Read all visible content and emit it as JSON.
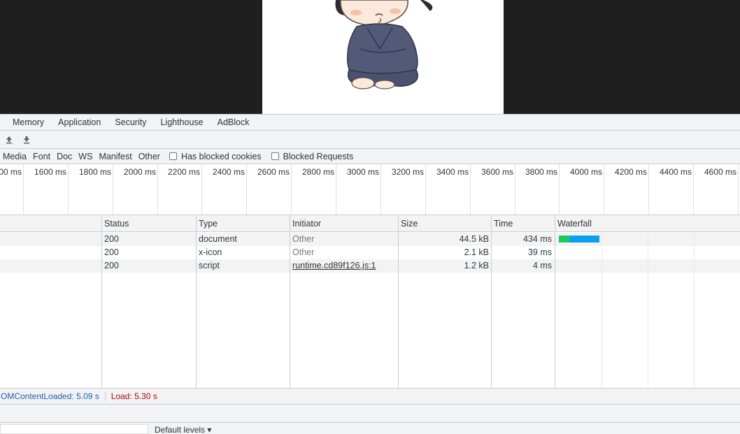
{
  "tabs": [
    "Memory",
    "Application",
    "Security",
    "Lighthouse",
    "AdBlock"
  ],
  "toolbar": {
    "import_icon": "upload-arrow-icon",
    "export_icon": "download-arrow-icon"
  },
  "filters": [
    "Media",
    "Font",
    "Doc",
    "WS",
    "Manifest",
    "Other"
  ],
  "checkboxes": {
    "blocked_cookies": "Has blocked cookies",
    "blocked_requests": "Blocked Requests"
  },
  "overview_ticks": [
    "00 ms",
    "1600 ms",
    "1800 ms",
    "2000 ms",
    "2200 ms",
    "2400 ms",
    "2600 ms",
    "2800 ms",
    "3000 ms",
    "3200 ms",
    "3400 ms",
    "3600 ms",
    "3800 ms",
    "4000 ms",
    "4200 ms",
    "4400 ms",
    "4600 ms"
  ],
  "columns": {
    "status": "Status",
    "type": "Type",
    "initiator": "Initiator",
    "size": "Size",
    "time": "Time",
    "waterfall": "Waterfall"
  },
  "rows": [
    {
      "status": "200",
      "type": "document",
      "initiator": "Other",
      "size": "44.5 kB",
      "time": "434 ms"
    },
    {
      "status": "200",
      "type": "x-icon",
      "initiator": "Other",
      "size": "2.1 kB",
      "time": "39 ms"
    },
    {
      "status": "200",
      "type": "script",
      "initiator": "runtime.cd89f126.js:1",
      "size": "1.2 kB",
      "time": "4 ms"
    }
  ],
  "waterfall_colors": {
    "waiting": "#1ec963",
    "download": "#0ba0ee"
  },
  "summary": {
    "dom_content_loaded": "OMContentLoaded: 5.09 s",
    "load": "Load: 5.30 s"
  },
  "console": {
    "levels": "Default levels ▾"
  }
}
